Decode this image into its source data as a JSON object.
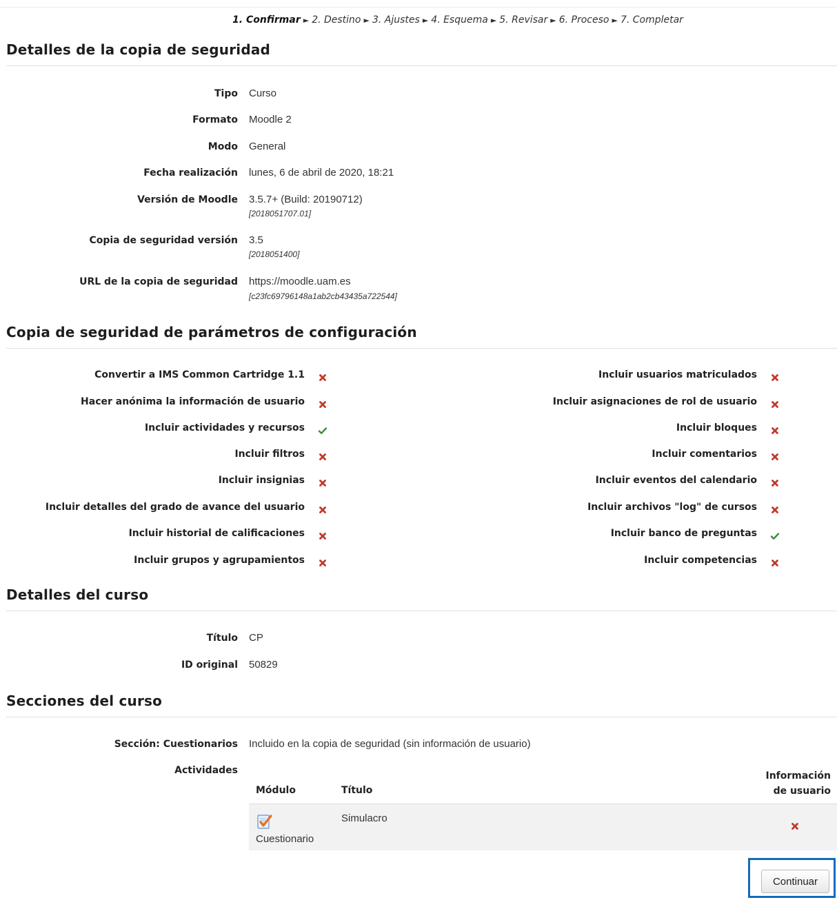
{
  "stepper": {
    "steps": [
      "1. Confirmar",
      "2. Destino",
      "3. Ajustes",
      "4. Esquema",
      "5. Revisar",
      "6. Proceso",
      "7. Completar"
    ],
    "separator": "►"
  },
  "backup_details": {
    "title": "Detalles de la copia de seguridad",
    "rows": [
      {
        "label": "Tipo",
        "value": "Curso"
      },
      {
        "label": "Formato",
        "value": "Moodle 2"
      },
      {
        "label": "Modo",
        "value": "General"
      },
      {
        "label": "Fecha realización",
        "value": "lunes, 6 de abril de 2020, 18:21"
      },
      {
        "label": "Versión de Moodle",
        "value": "3.5.7+ (Build: 20190712)",
        "sub": "[2018051707.01]"
      },
      {
        "label": "Copia de seguridad versión",
        "value": "3.5",
        "sub": "[2018051400]"
      },
      {
        "label": "URL de la copia de seguridad",
        "value": "https://moodle.uam.es",
        "sub": "[c23fc69796148a1ab2cb43435a722544]"
      }
    ]
  },
  "settings": {
    "title": "Copia de seguridad de parámetros de configuración",
    "left": [
      {
        "label": "Convertir a IMS Common Cartridge 1.1",
        "enabled": false
      },
      {
        "label": "Hacer anónima la información de usuario",
        "enabled": false
      },
      {
        "label": "Incluir actividades y recursos",
        "enabled": true
      },
      {
        "label": "Incluir filtros",
        "enabled": false
      },
      {
        "label": "Incluir insignias",
        "enabled": false
      },
      {
        "label": "Incluir detalles del grado de avance del usuario",
        "enabled": false
      },
      {
        "label": "Incluir historial de calificaciones",
        "enabled": false
      },
      {
        "label": "Incluir grupos y agrupamientos",
        "enabled": false
      }
    ],
    "right": [
      {
        "label": "Incluir usuarios matriculados",
        "enabled": false
      },
      {
        "label": "Incluir asignaciones de rol de usuario",
        "enabled": false
      },
      {
        "label": "Incluir bloques",
        "enabled": false
      },
      {
        "label": "Incluir comentarios",
        "enabled": false
      },
      {
        "label": "Incluir eventos del calendario",
        "enabled": false
      },
      {
        "label": "Incluir archivos \"log\" de cursos",
        "enabled": false
      },
      {
        "label": "Incluir banco de preguntas",
        "enabled": true
      },
      {
        "label": "Incluir competencias",
        "enabled": false
      }
    ],
    "icons": {
      "enabled": "check-icon",
      "disabled": "cross-icon"
    },
    "colors": {
      "enabled": "#3a8a3a",
      "disabled": "#c0392b"
    }
  },
  "course_details": {
    "title": "Detalles del curso",
    "rows": [
      {
        "label": "Título",
        "value": "CP"
      },
      {
        "label": "ID original",
        "value": "50829"
      }
    ]
  },
  "sections": {
    "title": "Secciones del curso",
    "section_label": "Sección: Cuestionarios",
    "section_value": "Incluido en la copia de seguridad (sin información de usuario)",
    "activities_label": "Actividades",
    "table": {
      "col_module": "Módulo",
      "col_title": "Título",
      "col_userinfo_line1": "Información",
      "col_userinfo_line2": "de usuario",
      "rows": [
        {
          "module": "Cuestionario",
          "module_icon": "quiz-icon",
          "title": "Simulacro",
          "userinfo": false
        }
      ]
    }
  },
  "actions": {
    "continue_label": "Continuar",
    "highlight_color": "#0f6cbf"
  }
}
